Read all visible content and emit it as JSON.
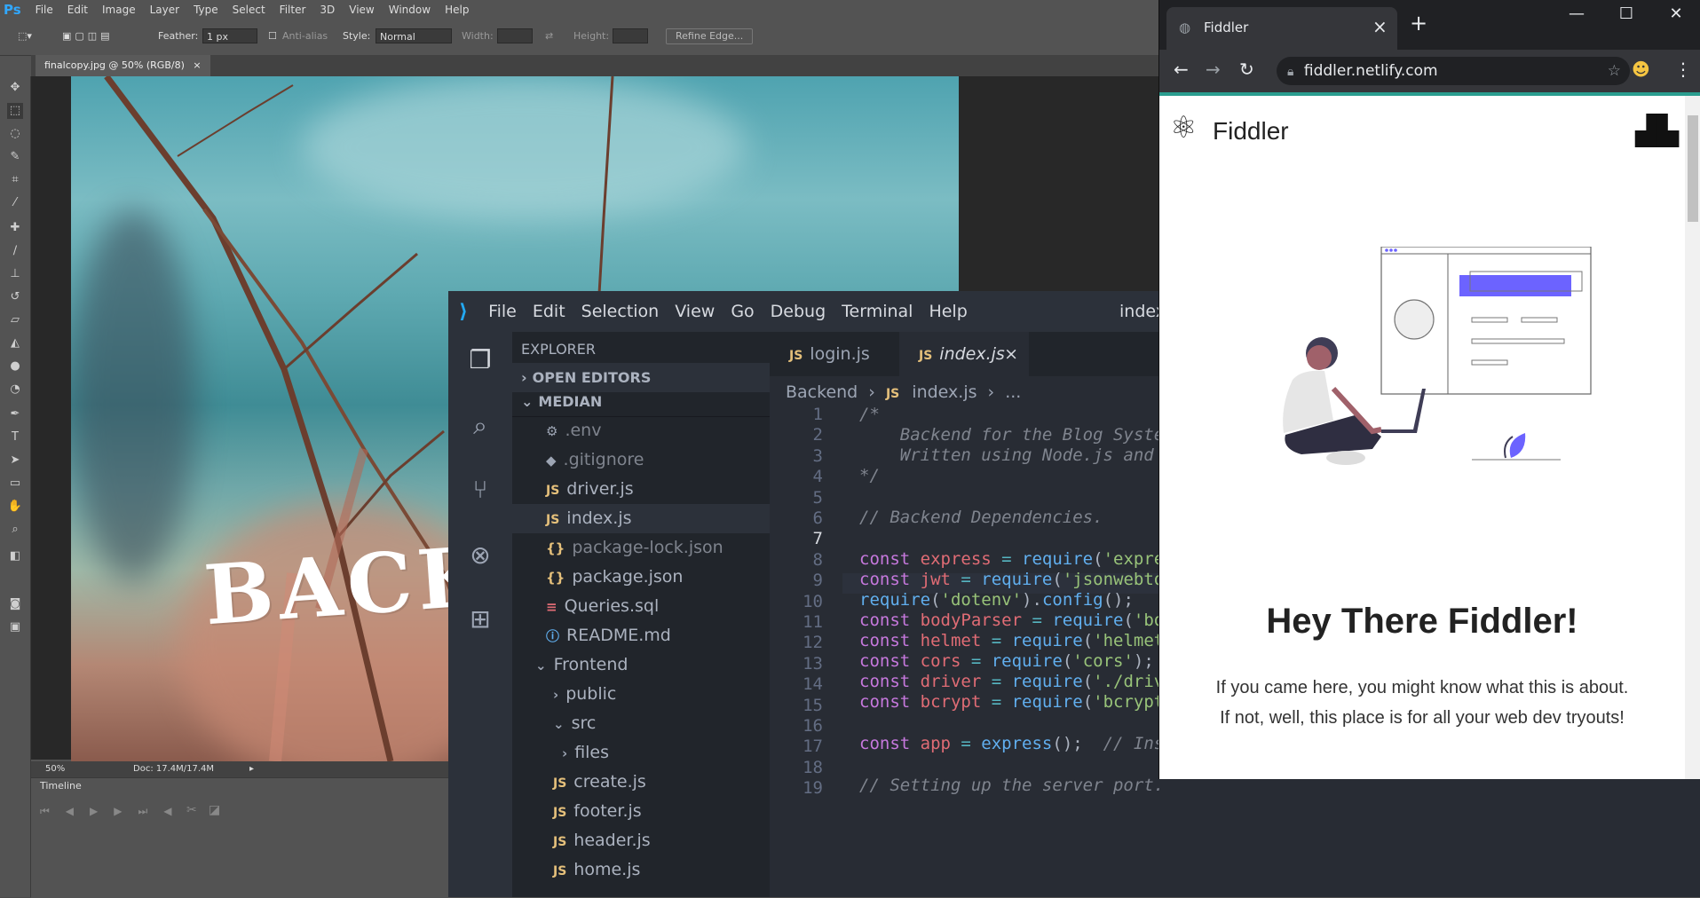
{
  "photoshop": {
    "logo": "Ps",
    "menu": [
      "File",
      "Edit",
      "Image",
      "Layer",
      "Type",
      "Select",
      "Filter",
      "3D",
      "View",
      "Window",
      "Help"
    ],
    "options": {
      "feather_label": "Feather:",
      "feather_value": "1 px",
      "anti_alias_label": "Anti-alias",
      "style_label": "Style:",
      "style_value": "Normal",
      "width_label": "Width:",
      "height_label": "Height:",
      "refine_edge_label": "Refine Edge..."
    },
    "document_tab": "finalcopy.jpg @ 50% (RGB/8)",
    "doc_tab_close": "×",
    "canvas_text": "BACK",
    "status": {
      "zoom": "50%",
      "doc_info": "Doc: 17.4M/17.4M"
    },
    "timeline_title": "Timeline"
  },
  "vscode": {
    "logo": "⟩",
    "menu": [
      "File",
      "Edit",
      "Selection",
      "View",
      "Go",
      "Debug",
      "Terminal",
      "Help"
    ],
    "window_title": "index",
    "sidebar": {
      "title": "EXPLORER",
      "open_editors": "OPEN EDITORS",
      "project": "MEDIAN",
      "files": [
        {
          "badge": "⚙",
          "name": ".env"
        },
        {
          "badge": "◆",
          "name": ".gitignore"
        },
        {
          "badge": "JS",
          "name": "driver.js"
        },
        {
          "badge": "JS",
          "name": "index.js"
        },
        {
          "badge": "{}",
          "name": "package-lock.json"
        },
        {
          "badge": "{}",
          "name": "package.json"
        },
        {
          "badge": "≡",
          "name": "Queries.sql"
        },
        {
          "badge": "ⓘ",
          "name": "README.md"
        },
        {
          "badge": "⌄",
          "name": "Frontend"
        },
        {
          "badge": "›",
          "name": "public"
        },
        {
          "badge": "⌄",
          "name": "src"
        },
        {
          "badge": "›",
          "name": "files"
        },
        {
          "badge": "JS",
          "name": "create.js"
        },
        {
          "badge": "JS",
          "name": "footer.js"
        },
        {
          "badge": "JS",
          "name": "header.js"
        },
        {
          "badge": "JS",
          "name": "home.js"
        }
      ]
    },
    "tabs": [
      {
        "badge": "JS",
        "label": "login.js"
      },
      {
        "badge": "JS",
        "label": "index.js"
      }
    ],
    "tab_close": "×",
    "breadcrumb": {
      "folder": "Backend",
      "sep": "›",
      "badge": "JS",
      "file": "index.js",
      "more": "..."
    },
    "line_numbers": [
      "1",
      "2",
      "3",
      "4",
      "5",
      "6",
      "7",
      "8",
      "9",
      "10",
      "11",
      "12",
      "13",
      "14",
      "15",
      "16",
      "17",
      "18",
      "19"
    ],
    "code": {
      "l1": "/*",
      "l2": "    Backend for the Blog Syste",
      "l3": "    Written using Node.js and",
      "l4": "*/",
      "l6": "// Backend Dependencies.",
      "l8_var": "express",
      "l8_arg": "'expre",
      "l9_var": "jwt",
      "l9_arg": "'jsonwebto",
      "l10_arg": "'dotenv'",
      "l10_fn": "config",
      "l11_var": "bodyParser",
      "l11_arg": "'bo",
      "l12_var": "helmet",
      "l12_arg": "'helmet",
      "l13_var": "cors",
      "l13_arg": "'cors'",
      "l14_var": "driver",
      "l14_arg": "'./driv",
      "l15_var": "bcrypt",
      "l15_arg": "'bcrypt",
      "l17_var": "app",
      "l17_fn": "express",
      "l17_comment": "// Instantiating the Express app.",
      "l19": "// Setting up the server port."
    }
  },
  "chrome": {
    "tab_title": "Fiddler",
    "tab_close": "×",
    "new_tab": "+",
    "url": "fiddler.netlify.com",
    "window_controls": [
      "—",
      "☐",
      "✕"
    ],
    "page": {
      "brand": "Fiddler",
      "heading": "Hey There Fiddler!",
      "body": "If you came here, you might know what this is about. If not, well, this place is for all your web dev tryouts!"
    }
  },
  "colors": {
    "ps_bg": "#535353",
    "vscode_accent": "#23a9f2",
    "chrome_accent": "#2a9d8f",
    "illustration_accent": "#6c63ff"
  }
}
